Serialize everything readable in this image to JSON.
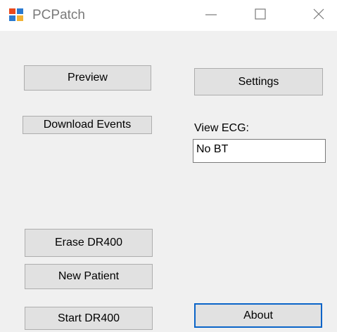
{
  "window": {
    "title": "PCPatch",
    "controls": {
      "minimize_icon": "minimize-icon",
      "maximize_icon": "maximize-icon",
      "close_icon": "close-icon"
    }
  },
  "buttons": {
    "preview": "Preview",
    "settings": "Settings",
    "download_events": "Download Events",
    "erase": "Erase DR400",
    "new_patient": "New Patient",
    "start": "Start DR400",
    "about": "About"
  },
  "view_ecg": {
    "label": "View ECG:",
    "value": "No BT"
  },
  "colors": {
    "background": "#f0f0f0",
    "button_face": "#e1e1e1",
    "focus_border": "#0a64c8"
  }
}
